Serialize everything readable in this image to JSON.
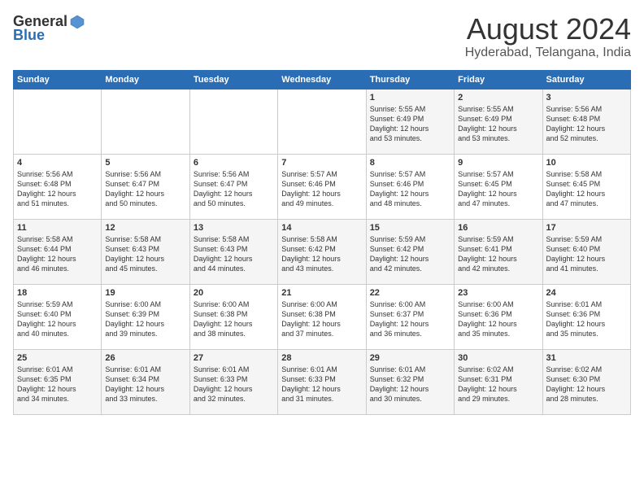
{
  "header": {
    "logo_general": "General",
    "logo_blue": "Blue",
    "month_year": "August 2024",
    "location": "Hyderabad, Telangana, India"
  },
  "weekdays": [
    "Sunday",
    "Monday",
    "Tuesday",
    "Wednesday",
    "Thursday",
    "Friday",
    "Saturday"
  ],
  "weeks": [
    [
      {
        "day": "",
        "info": ""
      },
      {
        "day": "",
        "info": ""
      },
      {
        "day": "",
        "info": ""
      },
      {
        "day": "",
        "info": ""
      },
      {
        "day": "1",
        "info": "Sunrise: 5:55 AM\nSunset: 6:49 PM\nDaylight: 12 hours\nand 53 minutes."
      },
      {
        "day": "2",
        "info": "Sunrise: 5:55 AM\nSunset: 6:49 PM\nDaylight: 12 hours\nand 53 minutes."
      },
      {
        "day": "3",
        "info": "Sunrise: 5:56 AM\nSunset: 6:48 PM\nDaylight: 12 hours\nand 52 minutes."
      }
    ],
    [
      {
        "day": "4",
        "info": "Sunrise: 5:56 AM\nSunset: 6:48 PM\nDaylight: 12 hours\nand 51 minutes."
      },
      {
        "day": "5",
        "info": "Sunrise: 5:56 AM\nSunset: 6:47 PM\nDaylight: 12 hours\nand 50 minutes."
      },
      {
        "day": "6",
        "info": "Sunrise: 5:56 AM\nSunset: 6:47 PM\nDaylight: 12 hours\nand 50 minutes."
      },
      {
        "day": "7",
        "info": "Sunrise: 5:57 AM\nSunset: 6:46 PM\nDaylight: 12 hours\nand 49 minutes."
      },
      {
        "day": "8",
        "info": "Sunrise: 5:57 AM\nSunset: 6:46 PM\nDaylight: 12 hours\nand 48 minutes."
      },
      {
        "day": "9",
        "info": "Sunrise: 5:57 AM\nSunset: 6:45 PM\nDaylight: 12 hours\nand 47 minutes."
      },
      {
        "day": "10",
        "info": "Sunrise: 5:58 AM\nSunset: 6:45 PM\nDaylight: 12 hours\nand 47 minutes."
      }
    ],
    [
      {
        "day": "11",
        "info": "Sunrise: 5:58 AM\nSunset: 6:44 PM\nDaylight: 12 hours\nand 46 minutes."
      },
      {
        "day": "12",
        "info": "Sunrise: 5:58 AM\nSunset: 6:43 PM\nDaylight: 12 hours\nand 45 minutes."
      },
      {
        "day": "13",
        "info": "Sunrise: 5:58 AM\nSunset: 6:43 PM\nDaylight: 12 hours\nand 44 minutes."
      },
      {
        "day": "14",
        "info": "Sunrise: 5:58 AM\nSunset: 6:42 PM\nDaylight: 12 hours\nand 43 minutes."
      },
      {
        "day": "15",
        "info": "Sunrise: 5:59 AM\nSunset: 6:42 PM\nDaylight: 12 hours\nand 42 minutes."
      },
      {
        "day": "16",
        "info": "Sunrise: 5:59 AM\nSunset: 6:41 PM\nDaylight: 12 hours\nand 42 minutes."
      },
      {
        "day": "17",
        "info": "Sunrise: 5:59 AM\nSunset: 6:40 PM\nDaylight: 12 hours\nand 41 minutes."
      }
    ],
    [
      {
        "day": "18",
        "info": "Sunrise: 5:59 AM\nSunset: 6:40 PM\nDaylight: 12 hours\nand 40 minutes."
      },
      {
        "day": "19",
        "info": "Sunrise: 6:00 AM\nSunset: 6:39 PM\nDaylight: 12 hours\nand 39 minutes."
      },
      {
        "day": "20",
        "info": "Sunrise: 6:00 AM\nSunset: 6:38 PM\nDaylight: 12 hours\nand 38 minutes."
      },
      {
        "day": "21",
        "info": "Sunrise: 6:00 AM\nSunset: 6:38 PM\nDaylight: 12 hours\nand 37 minutes."
      },
      {
        "day": "22",
        "info": "Sunrise: 6:00 AM\nSunset: 6:37 PM\nDaylight: 12 hours\nand 36 minutes."
      },
      {
        "day": "23",
        "info": "Sunrise: 6:00 AM\nSunset: 6:36 PM\nDaylight: 12 hours\nand 35 minutes."
      },
      {
        "day": "24",
        "info": "Sunrise: 6:01 AM\nSunset: 6:36 PM\nDaylight: 12 hours\nand 35 minutes."
      }
    ],
    [
      {
        "day": "25",
        "info": "Sunrise: 6:01 AM\nSunset: 6:35 PM\nDaylight: 12 hours\nand 34 minutes."
      },
      {
        "day": "26",
        "info": "Sunrise: 6:01 AM\nSunset: 6:34 PM\nDaylight: 12 hours\nand 33 minutes."
      },
      {
        "day": "27",
        "info": "Sunrise: 6:01 AM\nSunset: 6:33 PM\nDaylight: 12 hours\nand 32 minutes."
      },
      {
        "day": "28",
        "info": "Sunrise: 6:01 AM\nSunset: 6:33 PM\nDaylight: 12 hours\nand 31 minutes."
      },
      {
        "day": "29",
        "info": "Sunrise: 6:01 AM\nSunset: 6:32 PM\nDaylight: 12 hours\nand 30 minutes."
      },
      {
        "day": "30",
        "info": "Sunrise: 6:02 AM\nSunset: 6:31 PM\nDaylight: 12 hours\nand 29 minutes."
      },
      {
        "day": "31",
        "info": "Sunrise: 6:02 AM\nSunset: 6:30 PM\nDaylight: 12 hours\nand 28 minutes."
      }
    ]
  ]
}
